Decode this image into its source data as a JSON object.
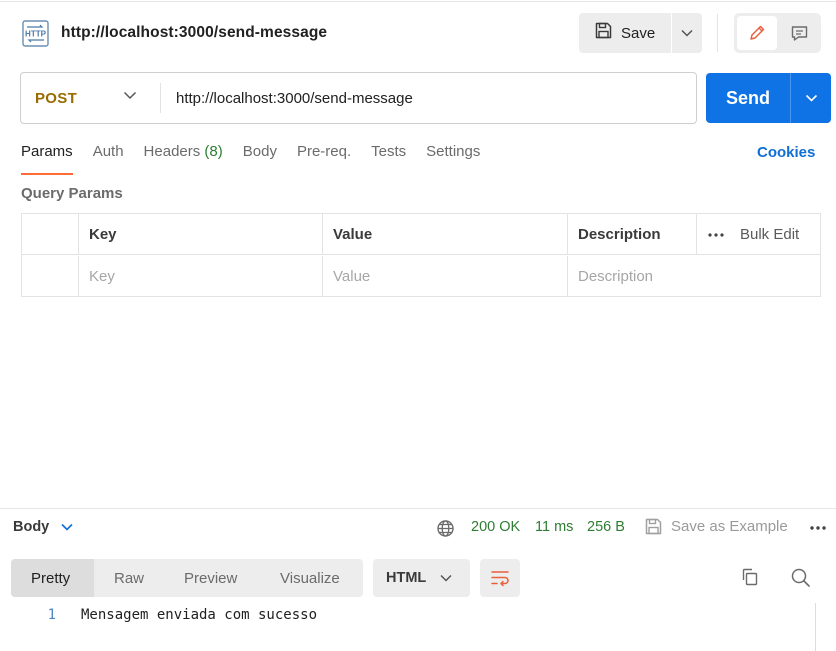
{
  "request": {
    "title": "http://localhost:3000/send-message",
    "save_label": "Save",
    "method": "POST",
    "url": "http://localhost:3000/send-message",
    "send_label": "Send"
  },
  "tabs": [
    {
      "label": "Params",
      "active": true
    },
    {
      "label": "Auth"
    },
    {
      "label": "Headers",
      "count": "(8)"
    },
    {
      "label": "Body"
    },
    {
      "label": "Pre-req."
    },
    {
      "label": "Tests"
    },
    {
      "label": "Settings"
    }
  ],
  "cookies_label": "Cookies",
  "query_params": {
    "title": "Query Params",
    "headers": [
      "Key",
      "Value",
      "Description"
    ],
    "bulk_edit": "Bulk Edit",
    "placeholders": [
      "Key",
      "Value",
      "Description"
    ]
  },
  "response": {
    "body_label": "Body",
    "status": "200 OK",
    "time": "11 ms",
    "size": "256 B",
    "save_example": "Save as Example",
    "view_tabs": [
      "Pretty",
      "Raw",
      "Preview",
      "Visualize"
    ],
    "format": "HTML",
    "lines": [
      {
        "num": "1",
        "text": "Mensagem enviada com sucesso"
      }
    ]
  },
  "colors": {
    "accent_orange": "#ff6c37",
    "send_blue": "#0f72e5",
    "method_post": "#9a6b00",
    "status_green": "#2e7d32",
    "link_blue": "#0f6fd6"
  },
  "icons": [
    "http-icon",
    "save-icon",
    "chevron-down-icon",
    "pencil-icon",
    "comment-icon",
    "more-icon",
    "globe-icon",
    "wrap-lines-icon",
    "copy-icon",
    "search-icon"
  ]
}
